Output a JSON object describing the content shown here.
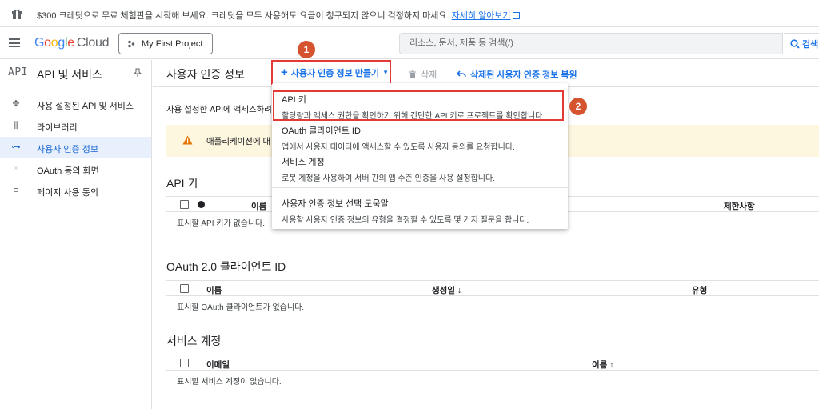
{
  "banner": {
    "text": "$300 크레딧으로 무료 체험판을 시작해 보세요. 크레딧을 모두 사용해도 요금이 청구되지 않으니 걱정하지 마세요.",
    "link": "자세히 알아보기"
  },
  "topbar": {
    "logo_parts": [
      "G",
      "o",
      "o",
      "g",
      "l",
      "e"
    ],
    "logo_cloud": "Cloud",
    "project": "My First Project",
    "search_placeholder": "리소스, 문서, 제품 등 검색(/)",
    "search_button": "검색"
  },
  "sidebar": {
    "api_logo": "API",
    "title": "API 및 서비스",
    "items": [
      {
        "label": "사용 설정된 API 및 서비스",
        "icon": "diamond-nodes-icon"
      },
      {
        "label": "라이브러리",
        "icon": "library-icon"
      },
      {
        "label": "사용자 인증 정보",
        "icon": "key-icon",
        "active": true
      },
      {
        "label": "OAuth 동의 화면",
        "icon": "oauth-grid-icon"
      },
      {
        "label": "페이지 사용 동의",
        "icon": "settings-list-icon"
      }
    ]
  },
  "main": {
    "title": "사용자 인증 정보",
    "create_button": "사용자 인증 정보 만들기",
    "delete_button": "삭제",
    "restore_button": "삭제된 사용자 인증 정보 복원",
    "description": "사용 설정한 API에 액세스하려",
    "warning": "애플리케이션에 대"
  },
  "dropdown": {
    "items": [
      {
        "title": "API 키",
        "subtitle": "할당량과 액세스 권한을 확인하기 위해 간단한 API 키로 프로젝트를 확인합니다."
      },
      {
        "title": "OAuth 클라이언트 ID",
        "subtitle": "앱에서 사용자 데이터에 액세스할 수 있도록 사용자 동의를 요청합니다."
      },
      {
        "title": "서비스 계정",
        "subtitle": "로봇 계정을 사용하여 서버 간의 앱 수준 인증을 사용 설정합니다."
      },
      {
        "title": "사용자 인증 정보 선택 도움말",
        "subtitle": "사용할 사용자 인증 정보의 유형을 결정할 수 있도록 몇 가지 질문을 합니다."
      }
    ]
  },
  "sections": {
    "api_keys": {
      "title": "API 키",
      "col_name": "이름",
      "col_restrictions": "제한사항",
      "empty": "표시할 API 키가 없습니다."
    },
    "oauth": {
      "title": "OAuth 2.0 클라이언트 ID",
      "col_name": "이름",
      "col_created": "생성일",
      "col_type": "유형",
      "empty": "표시할 OAuth 클라이언트가 없습니다."
    },
    "service_accounts": {
      "title": "서비스 계정",
      "col_email": "이메일",
      "col_name": "이름",
      "empty": "표시할 서비스 계정이 없습니다."
    }
  },
  "badges": {
    "one": "1",
    "two": "2"
  },
  "colors": {
    "accent": "#1a73e8",
    "highlight": "#e53935",
    "badge": "#d6532f",
    "warning_bg": "#fef7e0"
  }
}
